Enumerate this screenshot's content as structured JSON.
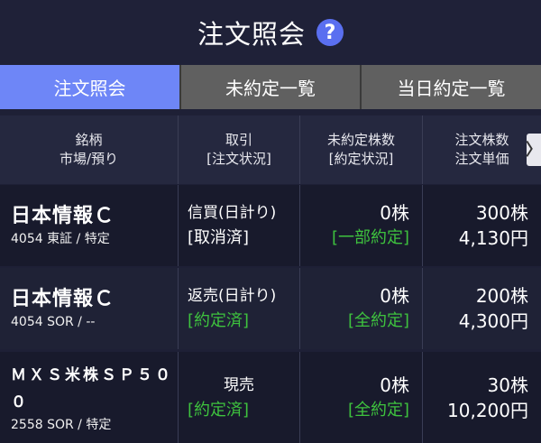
{
  "header": {
    "title": "注文照会",
    "help_icon": "?"
  },
  "tabs": [
    {
      "label": "注文照会",
      "active": true
    },
    {
      "label": "未約定一覧",
      "active": false
    },
    {
      "label": "当日約定一覧",
      "active": false
    }
  ],
  "table": {
    "headers": [
      {
        "line1": "銘柄",
        "line2": "市場/預り"
      },
      {
        "line1": "取引",
        "line2": "[注文状況]"
      },
      {
        "line1": "未約定株数",
        "line2": "[約定状況]"
      },
      {
        "line1": "注文株数",
        "line2": "注文単価"
      }
    ],
    "next_arrow": "〉",
    "rows": [
      {
        "name": "日本情報Ｃ",
        "market": "4054 東証 / 特定",
        "trade": "信買(日計り)",
        "order_status": "[取消済]",
        "unfilled": "0株",
        "fill_status": "[一部約定]",
        "quantity": "300株",
        "price": "4,130円"
      },
      {
        "name": "日本情報Ｃ",
        "market": "4054 SOR / --",
        "trade": "返売(日計り)",
        "order_status": "[約定済]",
        "unfilled": "0株",
        "fill_status": "[全約定]",
        "quantity": "200株",
        "price": "4,300円"
      },
      {
        "name": "ＭＸＳ米株ＳＰ５００",
        "market": "2558 SOR / 特定",
        "trade": "現売",
        "order_status": "[約定済]",
        "unfilled": "0株",
        "fill_status": "[全約定]",
        "quantity": "30株",
        "price": "10,200円"
      }
    ]
  },
  "colors": {
    "accent": "#6e86f7",
    "background": "#1e2036",
    "green_status": "#3ec23e",
    "tab_inactive": "#606060"
  }
}
